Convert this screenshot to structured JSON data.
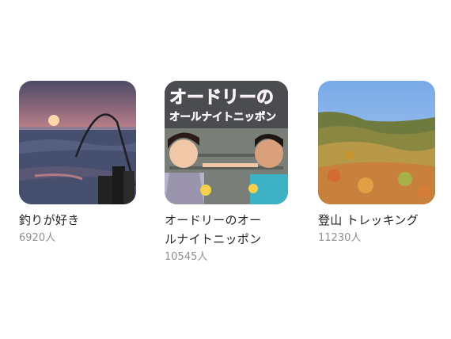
{
  "channels": [
    {
      "title": "釣りが好き",
      "title_lines": [
        "釣りが好き"
      ],
      "count": "6920人"
    },
    {
      "title": "オードリーのオールナイトニッポン",
      "title_lines": [
        "オードリーのオー",
        "ルナイトニッポン"
      ],
      "count": "10545人",
      "thumb_text": [
        "オードリーの",
        "オールナイトニッポン"
      ]
    },
    {
      "title": "登山 トレッキング",
      "title_lines": [
        "登山 トレッキング"
      ],
      "count": "11230人"
    }
  ],
  "icons": [
    "fishing-sunset-thumbnail",
    "radio-show-thumbnail",
    "mountain-autumn-thumbnail"
  ],
  "colors": {
    "text": "#222222",
    "subtext": "#8e8e93",
    "radio_title_pink": "#e97aa8"
  }
}
